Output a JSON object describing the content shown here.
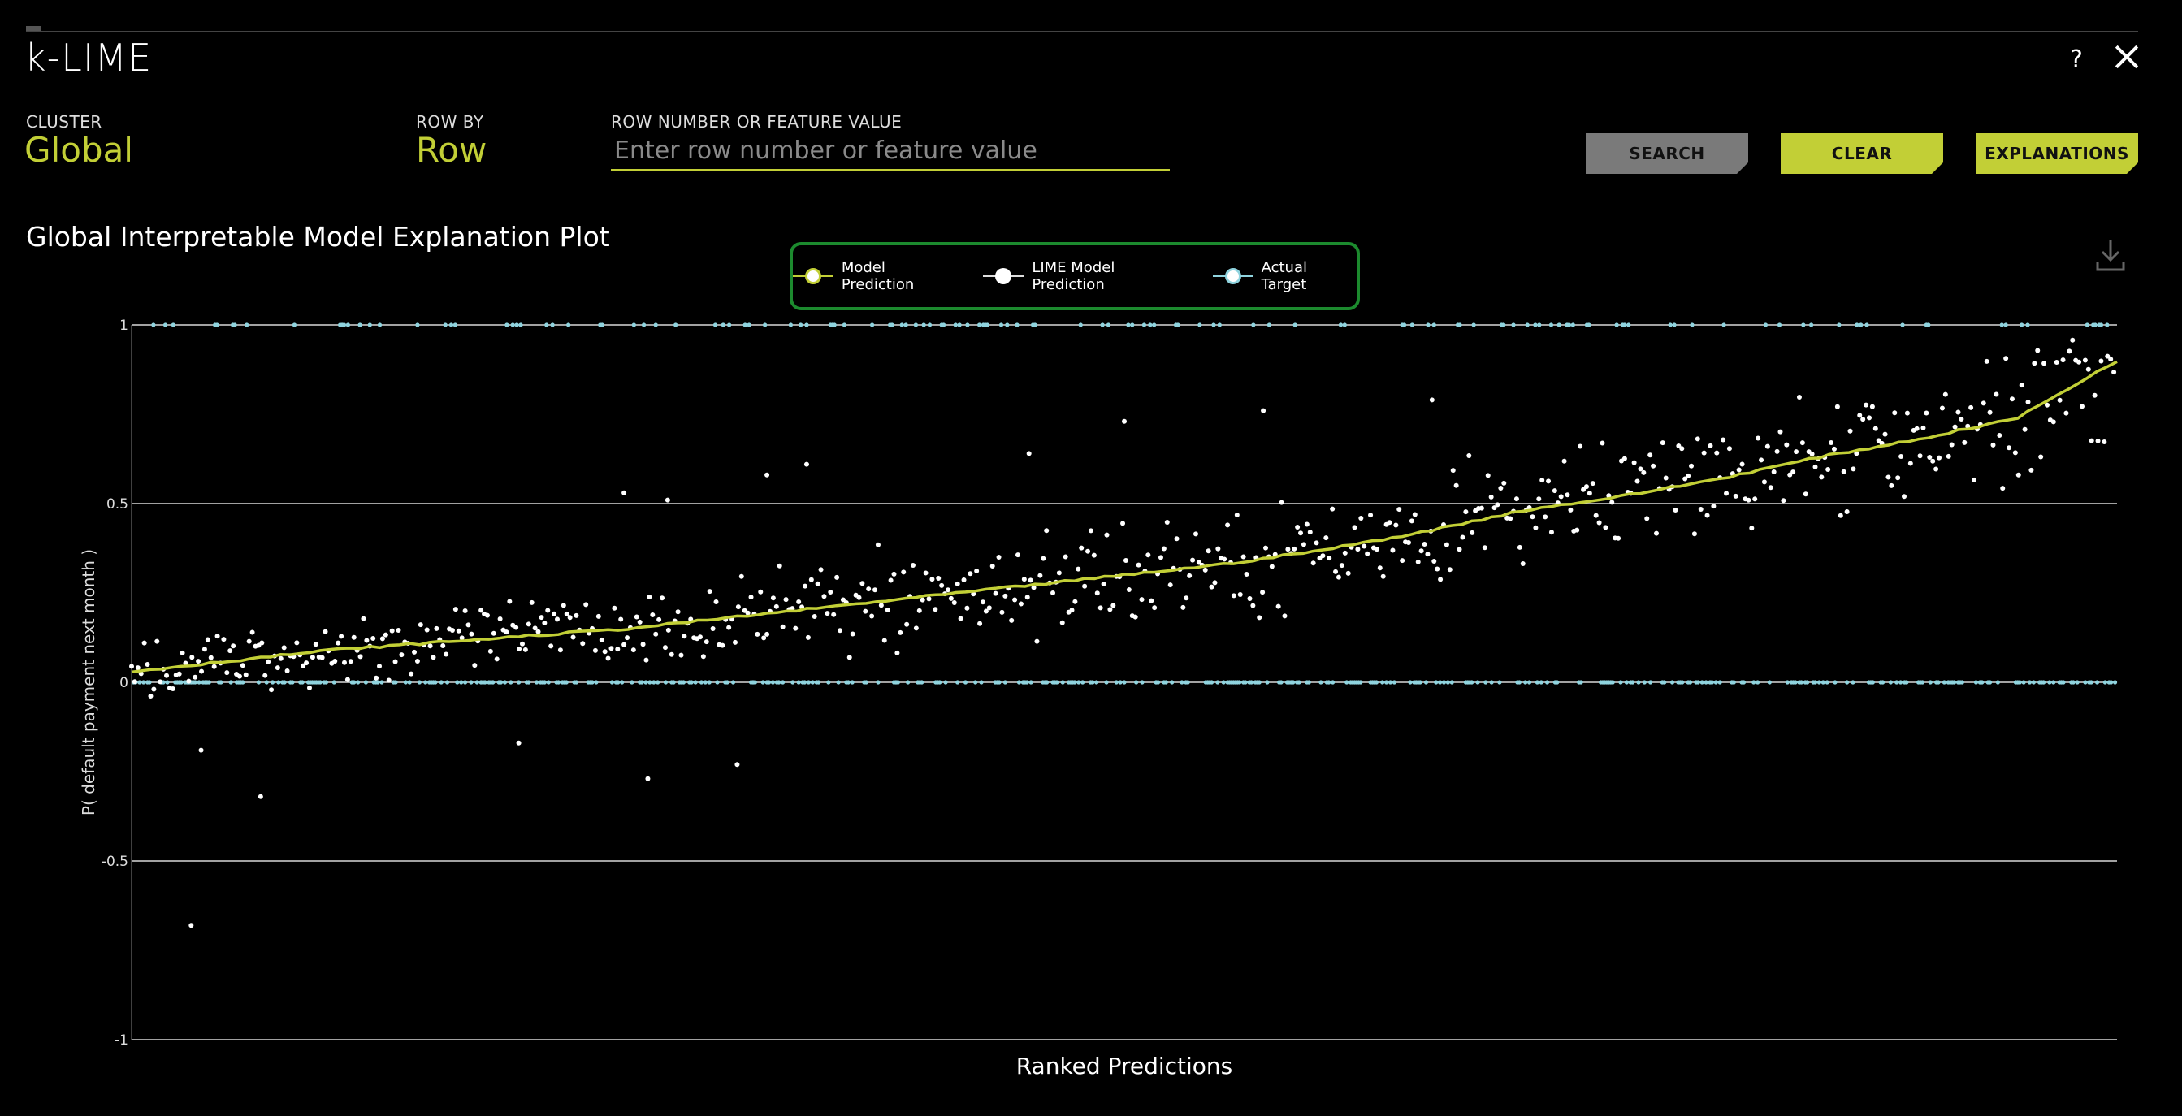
{
  "app": {
    "title": "k-LIME",
    "help_label": "?"
  },
  "controls": {
    "cluster_label": "CLUSTER",
    "cluster_value": "Global",
    "row_by_label": "ROW BY",
    "row_by_value": "Row",
    "search_field_label": "ROW NUMBER OR FEATURE VALUE",
    "search_placeholder": "Enter row number or feature value",
    "search_button": "SEARCH",
    "clear_button": "CLEAR",
    "explanations_button": "EXPLANATIONS"
  },
  "colors": {
    "accent": "#c2cf36",
    "model_prediction": "#c2cf36",
    "lime_prediction": "#ffffff",
    "actual_target": "#8fd3de",
    "legend_border": "#1c8a2e",
    "search_button": "#7a7a7a"
  },
  "plot": {
    "title": "Global Interpretable Model Explanation Plot",
    "download_icon": "download-icon"
  },
  "chart_data": {
    "type": "scatter",
    "title": "Global Interpretable Model Explanation Plot",
    "xlabel": "Ranked Predictions",
    "ylabel": "P( default payment next month )",
    "ylim": [
      -1,
      1
    ],
    "yticks": [
      "1",
      "0.5",
      "0",
      "-0.5",
      "-1"
    ],
    "ytick_values": [
      1,
      0.5,
      0,
      -0.5,
      -1
    ],
    "grid": true,
    "legend_position": "top-center",
    "n_points": 1000,
    "series": [
      {
        "name": "Model Prediction",
        "kind": "line",
        "x": [
          0,
          50,
          100,
          150,
          200,
          250,
          300,
          350,
          400,
          450,
          500,
          550,
          600,
          650,
          700,
          750,
          800,
          850,
          900,
          950,
          1000
        ],
        "y": [
          0.03,
          0.06,
          0.09,
          0.11,
          0.13,
          0.15,
          0.18,
          0.21,
          0.24,
          0.27,
          0.3,
          0.33,
          0.37,
          0.42,
          0.48,
          0.52,
          0.57,
          0.63,
          0.68,
          0.74,
          0.9
        ]
      },
      {
        "name": "LIME Model Prediction",
        "kind": "scatter",
        "spread": 0.12,
        "outliers": [
          [
            35,
            -0.19
          ],
          [
            65,
            -0.32
          ],
          [
            30,
            -0.68
          ],
          [
            195,
            -0.17
          ],
          [
            260,
            -0.27
          ],
          [
            305,
            -0.23
          ],
          [
            248,
            0.53
          ],
          [
            270,
            0.51
          ],
          [
            320,
            0.58
          ],
          [
            340,
            0.61
          ],
          [
            452,
            0.64
          ],
          [
            500,
            0.73
          ],
          [
            570,
            0.76
          ],
          [
            655,
            0.79
          ]
        ]
      },
      {
        "name": "Actual Target",
        "kind": "binary",
        "values": [
          0,
          1
        ],
        "positive_rate": 0.22
      }
    ]
  }
}
